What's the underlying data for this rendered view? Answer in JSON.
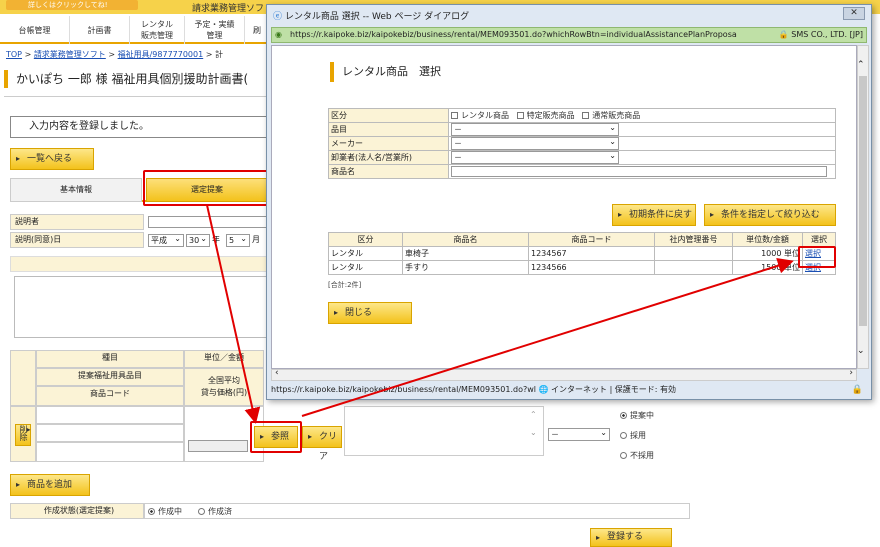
{
  "banner": "詳しくはクリックしてね!",
  "system_title": "請求業務管理ソフ",
  "nav": [
    "台帳管理",
    "計画書",
    "レンタル\n販売管理",
    "予定・実績\n管理",
    "刷"
  ],
  "breadcrumb": {
    "top": "TOP",
    "sep": ">",
    "item1": "請求業務管理ソフト",
    "item2": "福祉用具/9877770001",
    "item3": "計"
  },
  "page_title": "かいぽち 一郎 様 福祉用具個別援助計画書(",
  "notice": "入力内容を登録しました。",
  "back_button": "一覧へ戻る",
  "tabs": [
    "基本情報",
    "選定提案"
  ],
  "form": {
    "explainer_label": "説明者",
    "date_label": "説明(同意)日",
    "era": "平成",
    "year": "30",
    "year_unit": "年",
    "month": "5",
    "month_unit": "月"
  },
  "grid": {
    "h_item": "種目",
    "h_unit": "単位／金額",
    "h_proposed": "提案福祉用具品目",
    "h_code": "商品コード",
    "h_avg": "全国平均\n貸与価格(円)",
    "delete_label": "削除",
    "select_default": "－",
    "radios": [
      "提案中",
      "採用",
      "不採用"
    ]
  },
  "ref_button": "参照",
  "clear_button": "クリア",
  "add_product_button": "商品を追加",
  "status_row": {
    "label": "作成状態(選定提案)",
    "opt1": "作成中",
    "opt2": "作成済"
  },
  "register_button": "登録する",
  "dialog": {
    "title": "レンタル商品 選択 -- Web ページ ダイアログ",
    "close": "✕",
    "url": "https://r.kaipoke.biz/kaipokebiz/business/rental/MEM093501.do?whichRowBtn=individualAssistancePlanProposa",
    "cert": "SMS CO., LTD. [JP]",
    "heading": "レンタル商品　選択",
    "filter": {
      "kubun_label": "区分",
      "kubun_opts": [
        "レンタル商品",
        "特定販売商品",
        "通常販売商品"
      ],
      "hinmoku_label": "品目",
      "maker_label": "メーカー",
      "oroshi_label": "卸業者(法人名/営業所)",
      "shohinmei_label": "商品名",
      "select_default": "－"
    },
    "reset_button": "初期条件に戻す",
    "filter_button": "条件を指定して絞り込む",
    "table": {
      "headers": [
        "区分",
        "商品名",
        "商品コード",
        "社内管理番号",
        "単位数/金額",
        "選択"
      ],
      "rows": [
        {
          "kubun": "レンタル",
          "name": "車椅子",
          "code": "1234567",
          "internal": "",
          "price": "1000 単位",
          "select": "選択"
        },
        {
          "kubun": "レンタル",
          "name": "手すり",
          "code": "1234566",
          "internal": "",
          "price": "1500 単位",
          "select": "選択"
        }
      ],
      "total": "[合計:2件]"
    },
    "close_button": "閉じる",
    "statusbar": "https://r.kaipoke.biz/kaipokebiz/business/rental/MEM093501.do?wl 🌐 インターネット | 保護モード: 有効"
  },
  "colors": {
    "accent": "#f3c21b",
    "highlight": "#e10000",
    "link": "#1a4fb3"
  }
}
